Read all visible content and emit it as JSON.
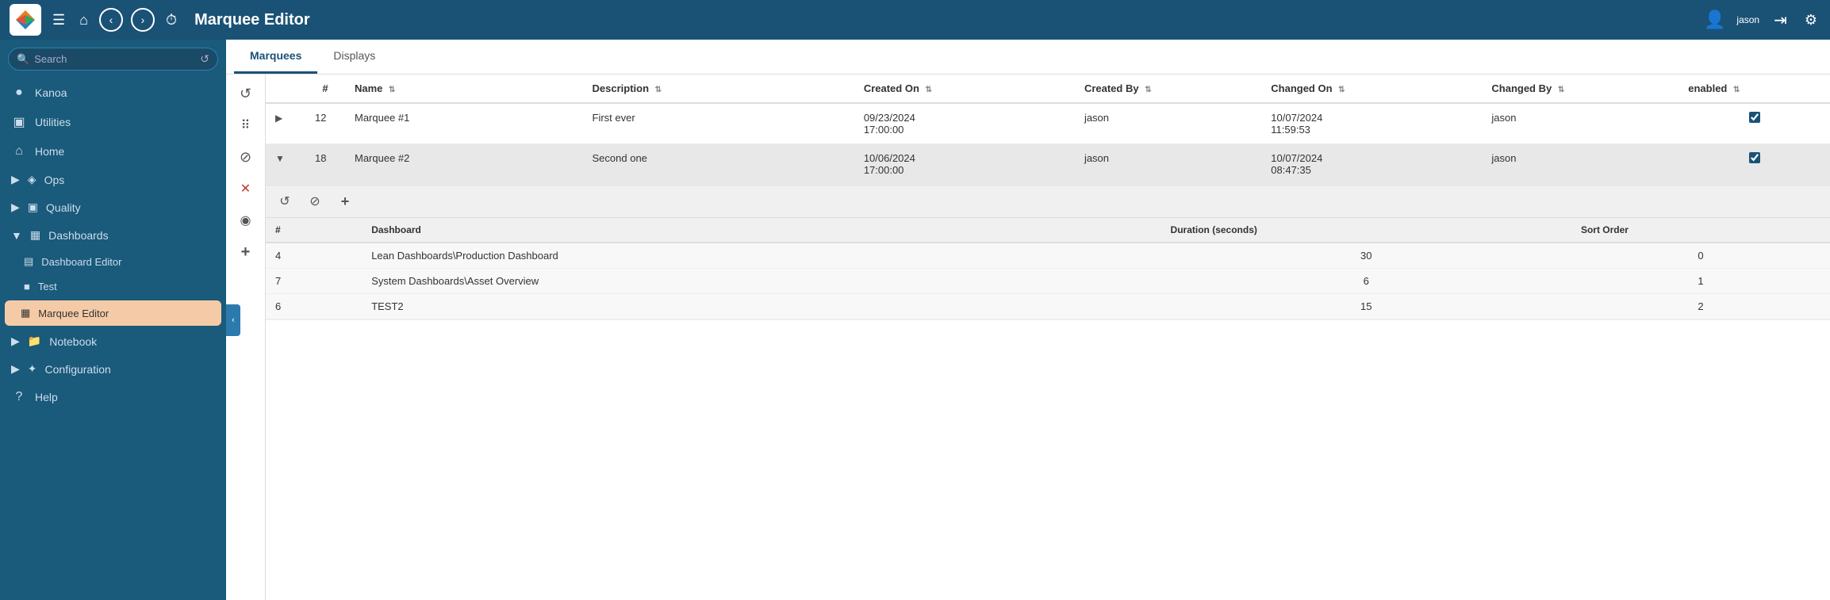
{
  "app": {
    "name": "kanoa",
    "page_title": "Marquee Editor"
  },
  "header": {
    "page_title": "Marquee Editor",
    "user_name": "jason",
    "icons": {
      "menu": "☰",
      "home": "⌂",
      "back": "‹",
      "forward": "›",
      "history": "⏱"
    }
  },
  "search": {
    "placeholder": "Search"
  },
  "sidebar": {
    "items": [
      {
        "id": "kanoa",
        "label": "Kanoa",
        "icon": "●"
      },
      {
        "id": "utilities",
        "label": "Utilities",
        "icon": "▣"
      },
      {
        "id": "home",
        "label": "Home",
        "icon": "⌂"
      },
      {
        "id": "ops",
        "label": "Ops",
        "icon": "◈"
      },
      {
        "id": "quality",
        "label": "Quality",
        "icon": "▣"
      },
      {
        "id": "dashboards",
        "label": "Dashboards",
        "icon": "▦"
      },
      {
        "id": "dashboard-editor",
        "label": "Dashboard Editor",
        "icon": "▤"
      },
      {
        "id": "test",
        "label": "Test",
        "icon": "■"
      },
      {
        "id": "marquee-editor",
        "label": "Marquee Editor",
        "icon": "▦"
      },
      {
        "id": "notebook",
        "label": "Notebook",
        "icon": "📁"
      },
      {
        "id": "configuration",
        "label": "Configuration",
        "icon": "✦"
      },
      {
        "id": "help",
        "label": "Help",
        "icon": "?"
      }
    ]
  },
  "tabs": [
    {
      "id": "marquees",
      "label": "Marquees",
      "active": true
    },
    {
      "id": "displays",
      "label": "Displays",
      "active": false
    }
  ],
  "table": {
    "columns": [
      {
        "id": "expand",
        "label": ""
      },
      {
        "id": "num",
        "label": "#"
      },
      {
        "id": "name",
        "label": "Name"
      },
      {
        "id": "description",
        "label": "Description"
      },
      {
        "id": "created_on",
        "label": "Created On"
      },
      {
        "id": "created_by",
        "label": "Created By"
      },
      {
        "id": "changed_on",
        "label": "Changed On"
      },
      {
        "id": "changed_by",
        "label": "Changed By"
      },
      {
        "id": "enabled",
        "label": "enabled"
      }
    ],
    "rows": [
      {
        "id": 1,
        "num": "12",
        "name": "Marquee #1",
        "description": "First ever",
        "created_on": "09/23/2024\n17:00:00",
        "created_by": "jason",
        "changed_on": "10/07/2024\n11:59:53",
        "changed_by": "jason",
        "enabled": true,
        "expanded": false
      },
      {
        "id": 2,
        "num": "18",
        "name": "Marquee #2",
        "description": "Second one",
        "created_on": "10/06/2024\n17:00:00",
        "created_by": "jason",
        "changed_on": "10/07/2024\n08:47:35",
        "changed_by": "jason",
        "enabled": true,
        "expanded": true
      }
    ],
    "sub_table": {
      "columns": [
        {
          "id": "num",
          "label": "#"
        },
        {
          "id": "dashboard",
          "label": "Dashboard"
        },
        {
          "id": "duration",
          "label": "Duration (seconds)"
        },
        {
          "id": "sort_order",
          "label": "Sort Order"
        }
      ],
      "rows": [
        {
          "num": "4",
          "dashboard": "Lean Dashboards\\Production Dashboard",
          "duration": "30",
          "sort_order": "0"
        },
        {
          "num": "7",
          "dashboard": "System Dashboards\\Asset Overview",
          "duration": "6",
          "sort_order": "1"
        },
        {
          "num": "6",
          "dashboard": "TEST2",
          "duration": "15",
          "sort_order": "2"
        }
      ]
    }
  },
  "toolbar": {
    "buttons": [
      {
        "id": "refresh",
        "icon": "↺",
        "label": "refresh"
      },
      {
        "id": "grid",
        "icon": "⠿",
        "label": "grid-view"
      },
      {
        "id": "block",
        "icon": "⊘",
        "label": "block"
      },
      {
        "id": "delete",
        "icon": "✕",
        "label": "delete"
      },
      {
        "id": "camera",
        "icon": "◉",
        "label": "camera"
      },
      {
        "id": "add",
        "icon": "+",
        "label": "add"
      }
    ],
    "sub_toolbar": [
      {
        "id": "sub-refresh",
        "icon": "↺",
        "label": "sub-refresh"
      },
      {
        "id": "sub-block",
        "icon": "⊘",
        "label": "sub-block"
      },
      {
        "id": "sub-add",
        "icon": "+",
        "label": "sub-add"
      }
    ]
  }
}
